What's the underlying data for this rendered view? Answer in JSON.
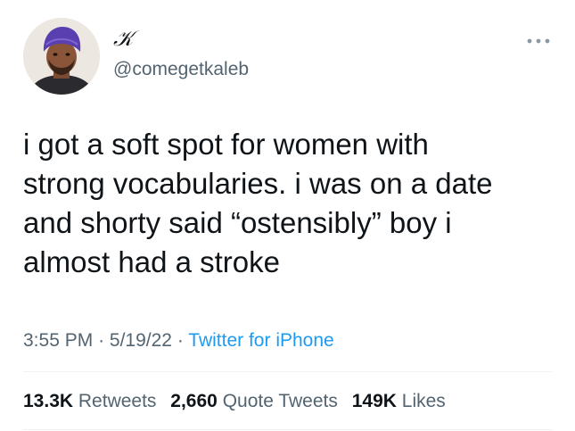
{
  "author": {
    "display_name": "𝒦",
    "handle": "@comegetkaleb"
  },
  "tweet": {
    "text": "i got a soft spot for women with\nstrong vocabularies. i was on a date\nand shorty said “ostensibly” boy i\nalmost had a stroke",
    "time": "3:55 PM",
    "date": "5/19/22",
    "separator": "·",
    "source": "Twitter for iPhone"
  },
  "stats": {
    "retweets_count": "13.3K",
    "retweets_label": "Retweets",
    "quote_count": "2,660",
    "quote_label": "Quote Tweets",
    "likes_count": "149K",
    "likes_label": "Likes"
  },
  "icons": {
    "more": "more-horizontal-icon"
  },
  "colors": {
    "text": "#0f1419",
    "secondary": "#536471",
    "link": "#1d9bf0",
    "divider": "#eff3f4"
  }
}
